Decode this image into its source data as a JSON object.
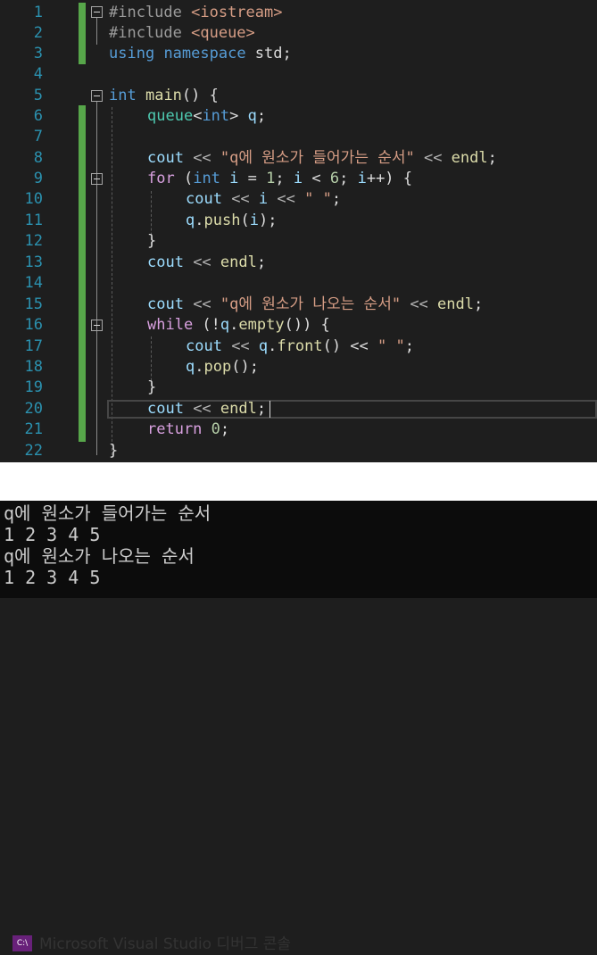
{
  "editor": {
    "line_numbers": [
      "1",
      "2",
      "3",
      "4",
      "5",
      "6",
      "7",
      "8",
      "9",
      "10",
      "11",
      "12",
      "13",
      "14",
      "15",
      "16",
      "17",
      "18",
      "19",
      "20",
      "21",
      "22"
    ],
    "lines": {
      "l1": [
        "#include ",
        "<iostream>"
      ],
      "l2": [
        "#include ",
        "<queue>"
      ],
      "l3": [
        "using",
        " ",
        "namespace",
        " std;"
      ],
      "l5": [
        "int",
        " ",
        "main",
        "() {"
      ],
      "l6": [
        "queue",
        "<",
        "int",
        ">",
        " ",
        "q",
        ";"
      ],
      "l8": [
        "cout",
        " << ",
        "\"q에 원소가 들어가는 순서\"",
        " << ",
        "endl",
        ";"
      ],
      "l9": [
        "for",
        " (",
        "int",
        " ",
        "i",
        " = ",
        "1",
        "; ",
        "i",
        " < ",
        "6",
        "; ",
        "i",
        "++) {"
      ],
      "l10": [
        "cout",
        " << ",
        "i",
        " << ",
        "\" \"",
        ";"
      ],
      "l11": [
        "q",
        ".",
        "push",
        "(",
        "i",
        ");"
      ],
      "l12": [
        "}"
      ],
      "l13": [
        "cout",
        " << ",
        "endl",
        ";"
      ],
      "l15": [
        "cout",
        " << ",
        "\"q에 원소가 나오는 순서\"",
        " << ",
        "endl",
        ";"
      ],
      "l16": [
        "while",
        " (!",
        "q",
        ".",
        "empty",
        "()) {"
      ],
      "l17": [
        "cout",
        " << ",
        "q",
        ".",
        "front",
        "() << ",
        "\" \"",
        ";"
      ],
      "l18": [
        "q",
        ".",
        "pop",
        "();"
      ],
      "l19": [
        "}"
      ],
      "l20": [
        "cout",
        " << ",
        "endl",
        ";"
      ],
      "l21": [
        "return",
        " ",
        "0",
        ";"
      ],
      "l22": [
        "}"
      ]
    }
  },
  "console": {
    "icon_label": "C:\\",
    "title": "Microsoft Visual Studio 디버그 콘솔",
    "output": [
      "q에 원소가 들어가는 순서",
      "1 2 3 4 5",
      "q에 원소가 나오는 순서",
      "1 2 3 4 5"
    ]
  },
  "colors": {
    "background": "#1e1e1e",
    "line_number": "#2b91af",
    "keyword": "#569cd6",
    "control_keyword": "#d8a0df",
    "type": "#4ec9b0",
    "string": "#d69d85",
    "number": "#b5cea8",
    "variable": "#9cdcfe",
    "function": "#dcdcaa",
    "change_bar": "#57a64a",
    "console_bg": "#0c0c0c"
  }
}
